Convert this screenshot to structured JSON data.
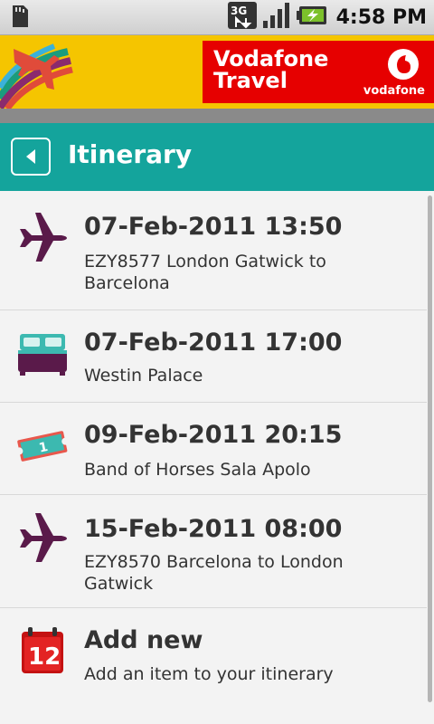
{
  "status_bar": {
    "time": "4:58 PM",
    "network": "3G",
    "icons": [
      "sd-card-icon",
      "network-3g-icon",
      "signal-icon",
      "battery-charging-icon"
    ]
  },
  "banner": {
    "brand_line1": "Vodafone",
    "brand_line2": "Travel",
    "brand_name": "vodafone"
  },
  "header": {
    "title": "Itinerary"
  },
  "itinerary": [
    {
      "icon": "plane-icon",
      "date": "07-Feb-2011 13:50",
      "description": "EZY8577 London Gatwick to Barcelona"
    },
    {
      "icon": "bed-icon",
      "date": "07-Feb-2011 17:00",
      "description": "Westin Palace"
    },
    {
      "icon": "ticket-icon",
      "date": "09-Feb-2011 20:15",
      "description": "Band of Horses Sala Apolo",
      "ticket_number": "1"
    },
    {
      "icon": "plane-icon",
      "date": "15-Feb-2011 08:00",
      "description": "EZY8570 Barcelona to London Gatwick"
    }
  ],
  "add_new": {
    "icon": "calendar-icon",
    "title": "Add new",
    "subtitle": "Add an item to your itinerary",
    "calendar_day": "12"
  },
  "colors": {
    "header": "#14a49c",
    "banner_yellow": "#f5c500",
    "vodafone_red": "#e60000",
    "icon_purple": "#5a1a4a"
  }
}
